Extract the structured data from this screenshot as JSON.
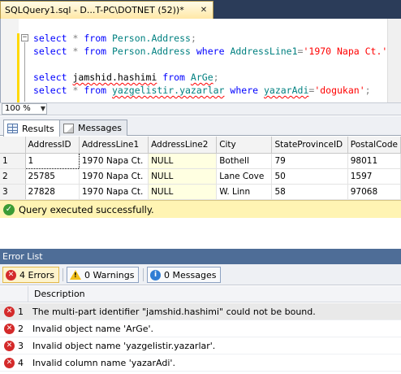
{
  "editor_tab": {
    "title": "SQLQuery1.sql - D...T-PC\\DOTNET (52))*",
    "close_glyph": "✕"
  },
  "code": {
    "lines": [
      [
        {
          "t": "select",
          "c": "kw"
        },
        {
          "t": " ",
          "c": "plain"
        },
        {
          "t": "*",
          "c": "op"
        },
        {
          "t": " ",
          "c": "plain"
        },
        {
          "t": "from",
          "c": "kw"
        },
        {
          "t": " ",
          "c": "plain"
        },
        {
          "t": "Person.Address",
          "c": "id"
        },
        {
          "t": ";",
          "c": "op"
        }
      ],
      [
        {
          "t": "select",
          "c": "kw"
        },
        {
          "t": " ",
          "c": "plain"
        },
        {
          "t": "*",
          "c": "op"
        },
        {
          "t": " ",
          "c": "plain"
        },
        {
          "t": "from",
          "c": "kw"
        },
        {
          "t": " ",
          "c": "plain"
        },
        {
          "t": "Person.Address",
          "c": "id"
        },
        {
          "t": " ",
          "c": "plain"
        },
        {
          "t": "where",
          "c": "kw"
        },
        {
          "t": " ",
          "c": "plain"
        },
        {
          "t": "AddressLine1",
          "c": "id"
        },
        {
          "t": "=",
          "c": "op"
        },
        {
          "t": "'1970 Napa Ct.'",
          "c": "str"
        },
        {
          "t": ";",
          "c": "op"
        }
      ],
      [],
      [
        {
          "t": "select",
          "c": "kw"
        },
        {
          "t": " ",
          "c": "plain"
        },
        {
          "t": "jamshid.hashimi",
          "c": "plain err"
        },
        {
          "t": " ",
          "c": "plain"
        },
        {
          "t": "from",
          "c": "kw"
        },
        {
          "t": " ",
          "c": "plain"
        },
        {
          "t": "ArGe",
          "c": "id err"
        },
        {
          "t": ";",
          "c": "op"
        }
      ],
      [
        {
          "t": "select",
          "c": "kw"
        },
        {
          "t": " ",
          "c": "plain"
        },
        {
          "t": "*",
          "c": "op"
        },
        {
          "t": " ",
          "c": "plain"
        },
        {
          "t": "from",
          "c": "kw"
        },
        {
          "t": " ",
          "c": "plain"
        },
        {
          "t": "yazgelistir.yazarlar",
          "c": "id err"
        },
        {
          "t": " ",
          "c": "plain"
        },
        {
          "t": "where",
          "c": "kw"
        },
        {
          "t": " ",
          "c": "plain"
        },
        {
          "t": "yazarAdi",
          "c": "id err"
        },
        {
          "t": "=",
          "c": "op"
        },
        {
          "t": "'dogukan'",
          "c": "str"
        },
        {
          "t": ";",
          "c": "op"
        }
      ]
    ],
    "collapse_glyph": "−"
  },
  "zoom": {
    "value": "100 %",
    "arrow": "▼"
  },
  "result_tabs": [
    {
      "label": "Results",
      "active": true
    },
    {
      "label": "Messages",
      "active": false
    }
  ],
  "results": {
    "columns": [
      "",
      "AddressID",
      "AddressLine1",
      "AddressLine2",
      "City",
      "StateProvinceID",
      "PostalCode"
    ],
    "rows": [
      [
        "1",
        "1",
        "1970 Napa Ct.",
        "NULL",
        "Bothell",
        "79",
        "98011"
      ],
      [
        "2",
        "25785",
        "1970 Napa Ct.",
        "NULL",
        "Lane Cove",
        "50",
        "1597"
      ],
      [
        "3",
        "27828",
        "1970 Napa Ct.",
        "NULL",
        "W. Linn",
        "58",
        "97068"
      ]
    ]
  },
  "status": {
    "text": "Query executed successfully.",
    "check_glyph": "✓"
  },
  "error_list": {
    "title": "Error List",
    "errors_button": "4 Errors",
    "warnings_button": "0 Warnings",
    "messages_button": "0 Messages",
    "column_description": "Description",
    "items": [
      {
        "num": "1",
        "text": "The multi-part identifier \"jamshid.hashimi\" could not be bound."
      },
      {
        "num": "2",
        "text": "Invalid object name 'ArGe'."
      },
      {
        "num": "3",
        "text": "Invalid object name 'yazgelistir.yazarlar'."
      },
      {
        "num": "4",
        "text": "Invalid column name 'yazarAdi'."
      }
    ]
  },
  "colors": {
    "status_bar": "#fff4b3",
    "error_red": "#d42a2a",
    "panel_title": "#4e6d97",
    "keyword": "#0000ff",
    "identifier": "#008080",
    "string": "#ff0000"
  }
}
